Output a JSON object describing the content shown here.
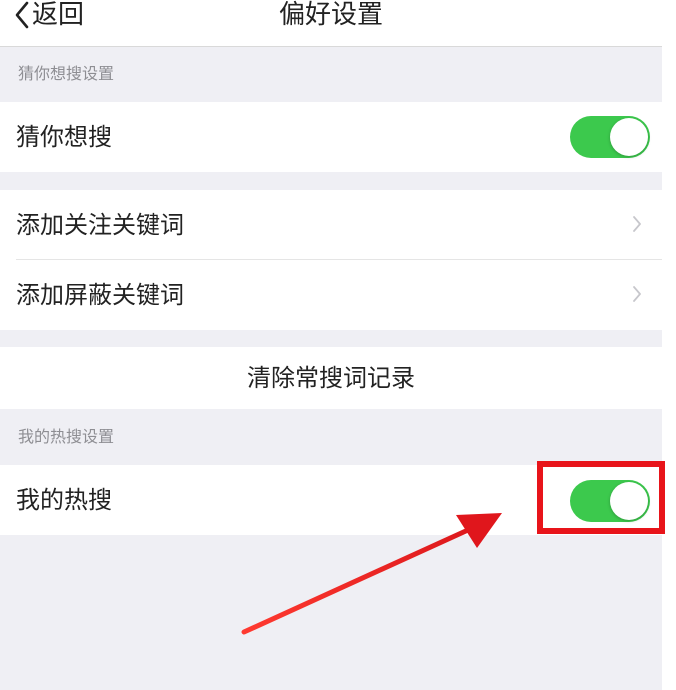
{
  "nav": {
    "back_label": "返回",
    "title": "偏好设置"
  },
  "sections": {
    "guess_header": "猜你想搜设置",
    "hot_header": "我的热搜设置"
  },
  "rows": {
    "guess_search": {
      "label": "猜你想搜",
      "toggle_on": true
    },
    "add_follow_keyword": {
      "label": "添加关注关键词"
    },
    "add_block_keyword": {
      "label": "添加屏蔽关键词"
    },
    "clear_history": {
      "label": "清除常搜词记录"
    },
    "my_hot_search": {
      "label": "我的热搜",
      "toggle_on": true
    }
  },
  "colors": {
    "toggle_on": "#3cc94d",
    "annotation_red": "#e8141a",
    "background": "#efeff4"
  },
  "icons": {
    "back": "chevron-left-icon",
    "disclosure": "chevron-right-icon"
  }
}
